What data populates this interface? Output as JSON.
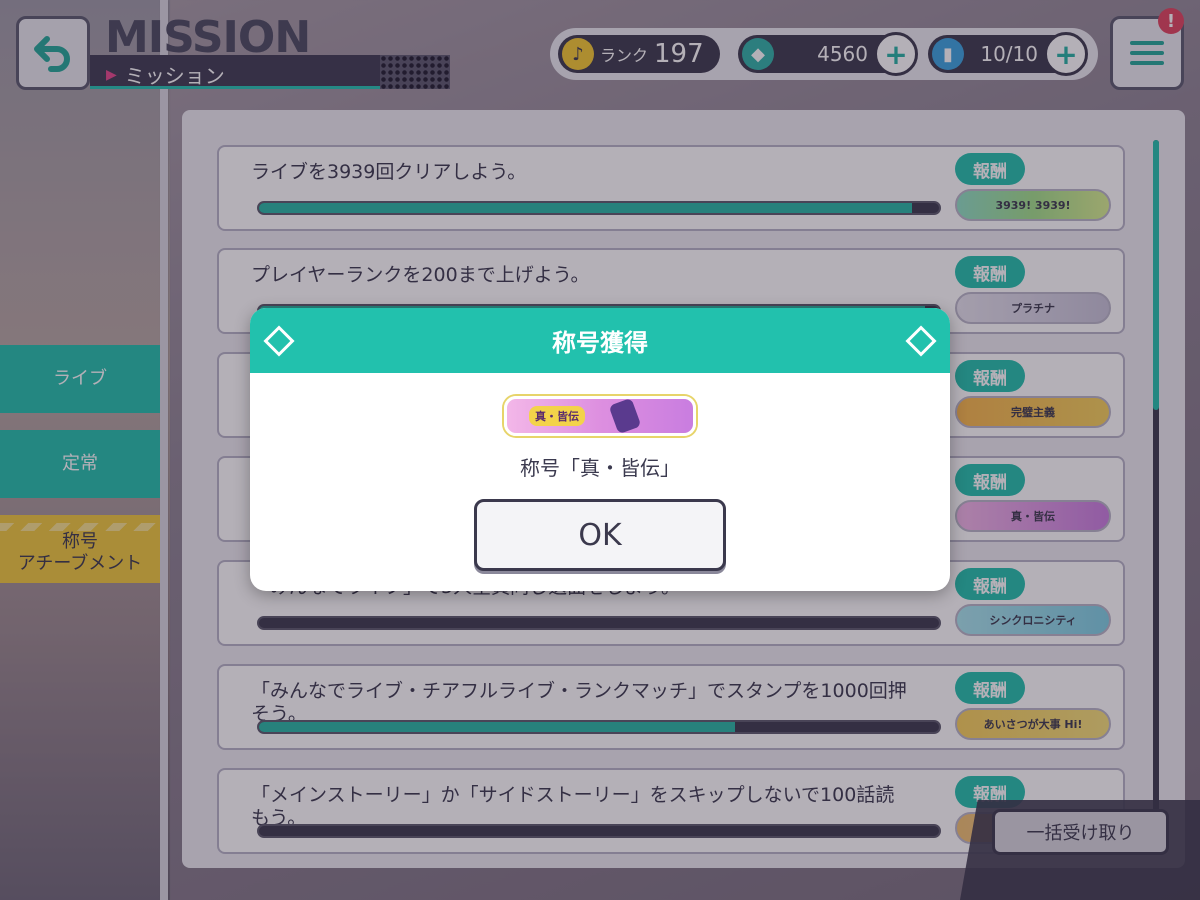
{
  "header": {
    "title_en": "MISSION",
    "title_jp": "ミッション",
    "rank_label": "ランク",
    "rank_value": "197",
    "gems": "4560",
    "tickets": "10/10",
    "alert_badge": "!"
  },
  "sidebar": {
    "items": [
      {
        "label": "ライブ"
      },
      {
        "label": "定常"
      },
      {
        "label": "称号\nアチーブメント"
      }
    ]
  },
  "missions": [
    {
      "text": "ライブを3939回クリアしよう。",
      "progress": 0.96,
      "reward_label": "報酬",
      "reward_name": "3939! 3939!"
    },
    {
      "text": "プレイヤーランクを200まで上げよう。",
      "progress": 0.98,
      "reward_label": "報酬",
      "reward_name": "プラチナ"
    },
    {
      "text": "",
      "progress": 0,
      "reward_label": "報酬",
      "reward_name": "完璧主義"
    },
    {
      "text": "",
      "progress": 0,
      "reward_label": "報酬",
      "reward_name": "真・皆伝"
    },
    {
      "text": "「みんなでライブ」で5人全員同じ選曲をしよう。",
      "progress": 0,
      "reward_label": "報酬",
      "reward_name": "シンクロニシティ"
    },
    {
      "text": "「みんなでライブ・チアフルライブ・ランクマッチ」でスタンプを1000回押そう。",
      "progress": 0.7,
      "reward_label": "報酬",
      "reward_name": "あいさつが大事 Hi!"
    },
    {
      "text": "「メインストーリー」か「サイドストーリー」をスキップしないで100話読もう。",
      "progress": 0,
      "reward_label": "報酬",
      "reward_name": ""
    }
  ],
  "bulk_receive": "一括受け取り",
  "modal": {
    "title": "称号獲得",
    "plate_tag": "真・皆伝",
    "caption": "称号「真・皆伝」",
    "ok": "OK"
  },
  "colors": {
    "accent": "#22c1ad",
    "dark": "#3b394d",
    "gold": "#f0c93c"
  }
}
